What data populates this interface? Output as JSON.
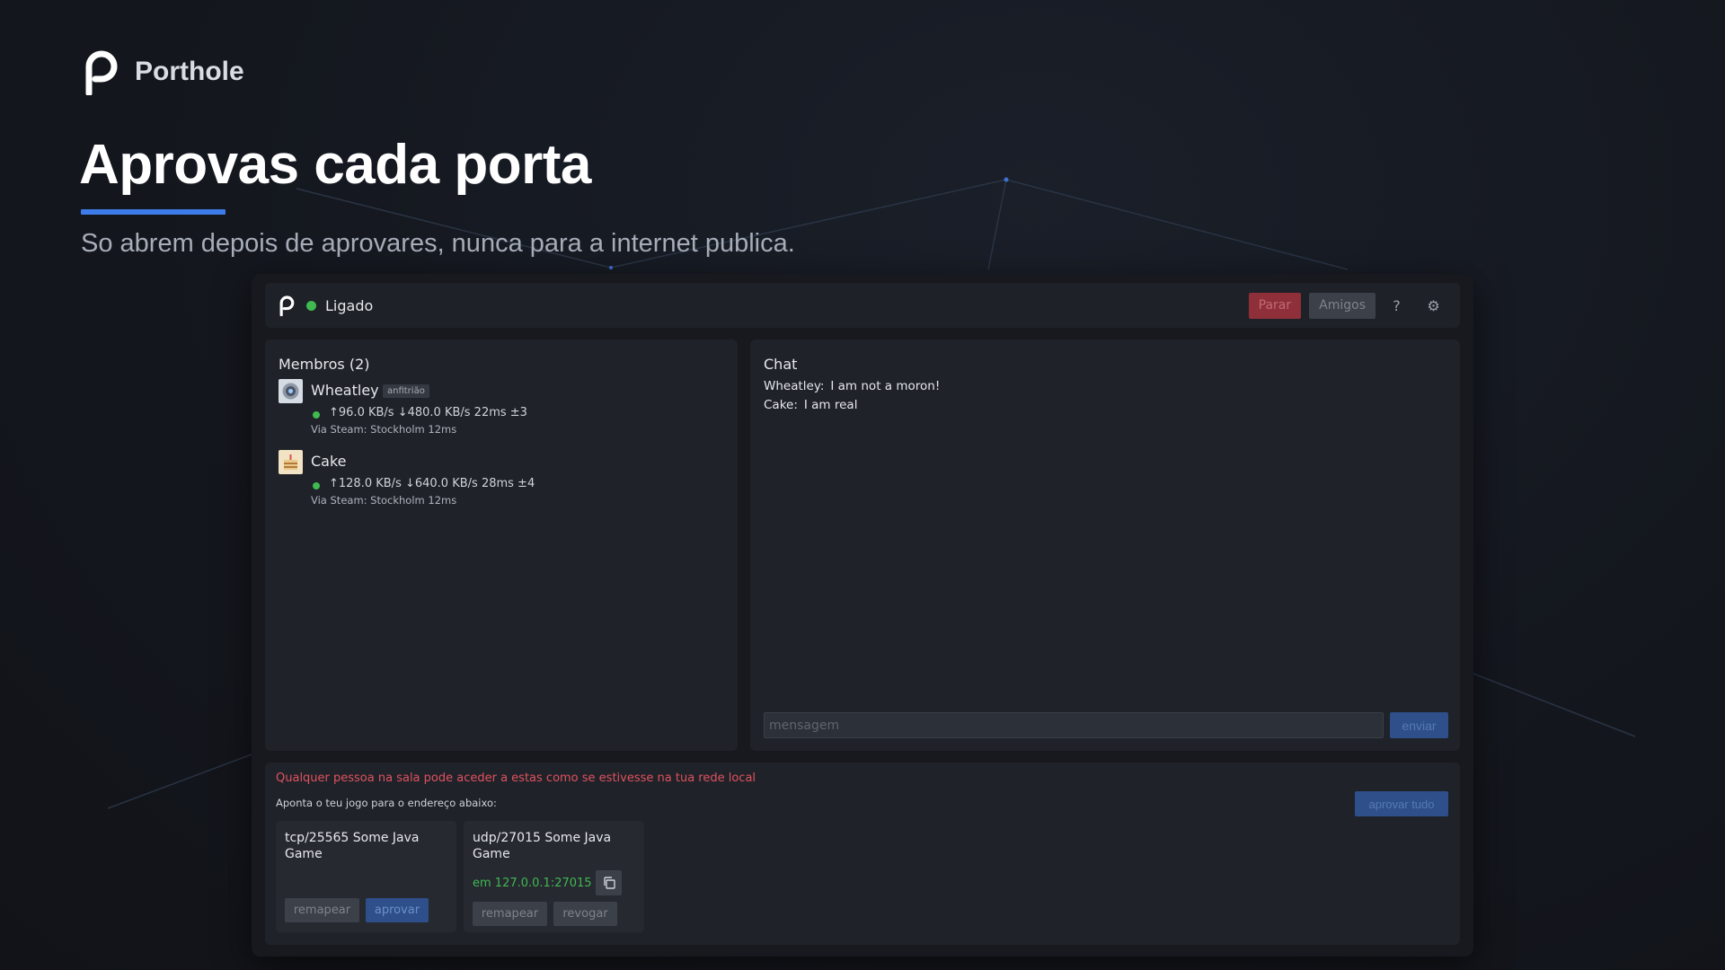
{
  "brand": {
    "name": "Porthole"
  },
  "hero": {
    "headline": "Aprovas cada porta",
    "subtitle": "So abrem depois de aprovares, nunca para a internet publica."
  },
  "topbar": {
    "status": "Ligado",
    "stop_label": "Parar",
    "friends_label": "Amigos",
    "help_icon": "?",
    "settings_icon": "⚙"
  },
  "members": {
    "title": "Membros (2)",
    "list": [
      {
        "name": "Wheatley",
        "badge": "anfitrião",
        "stats": "↑96.0 KB/s ↓480.0 KB/s  22ms ±3",
        "route": "Via Steam: Stockholm 12ms",
        "avatar": "eye-avatar"
      },
      {
        "name": "Cake",
        "badge": "",
        "stats": "↑128.0 KB/s ↓640.0 KB/s  28ms ±4",
        "route": "Via Steam: Stockholm 12ms",
        "avatar": "cake-avatar"
      }
    ]
  },
  "chat": {
    "title": "Chat",
    "messages": [
      {
        "from": "Wheatley:",
        "text": "I am not a moron!"
      },
      {
        "from": "Cake:",
        "text": "I am real"
      }
    ],
    "input_placeholder": "mensagem",
    "send_label": "enviar"
  },
  "ports": {
    "warning": "Qualquer pessoa na sala pode aceder a estas como se estivesse na tua rede local",
    "hint": "Aponta o teu jogo para o endereço abaixo:",
    "approve_all_label": "aprovar tudo",
    "cards": [
      {
        "name": "tcp/25565 Some Java Game",
        "remap_label": "remapear",
        "approve_label": "aprovar"
      },
      {
        "name": "udp/27015 Some Java Game",
        "address": "em 127.0.0.1:27015",
        "remap_label": "remapear",
        "revoke_label": "revogar"
      }
    ]
  },
  "colors": {
    "accent": "#3d7be8",
    "online": "#3fb950",
    "danger": "#e05260",
    "background": "#14171e"
  }
}
